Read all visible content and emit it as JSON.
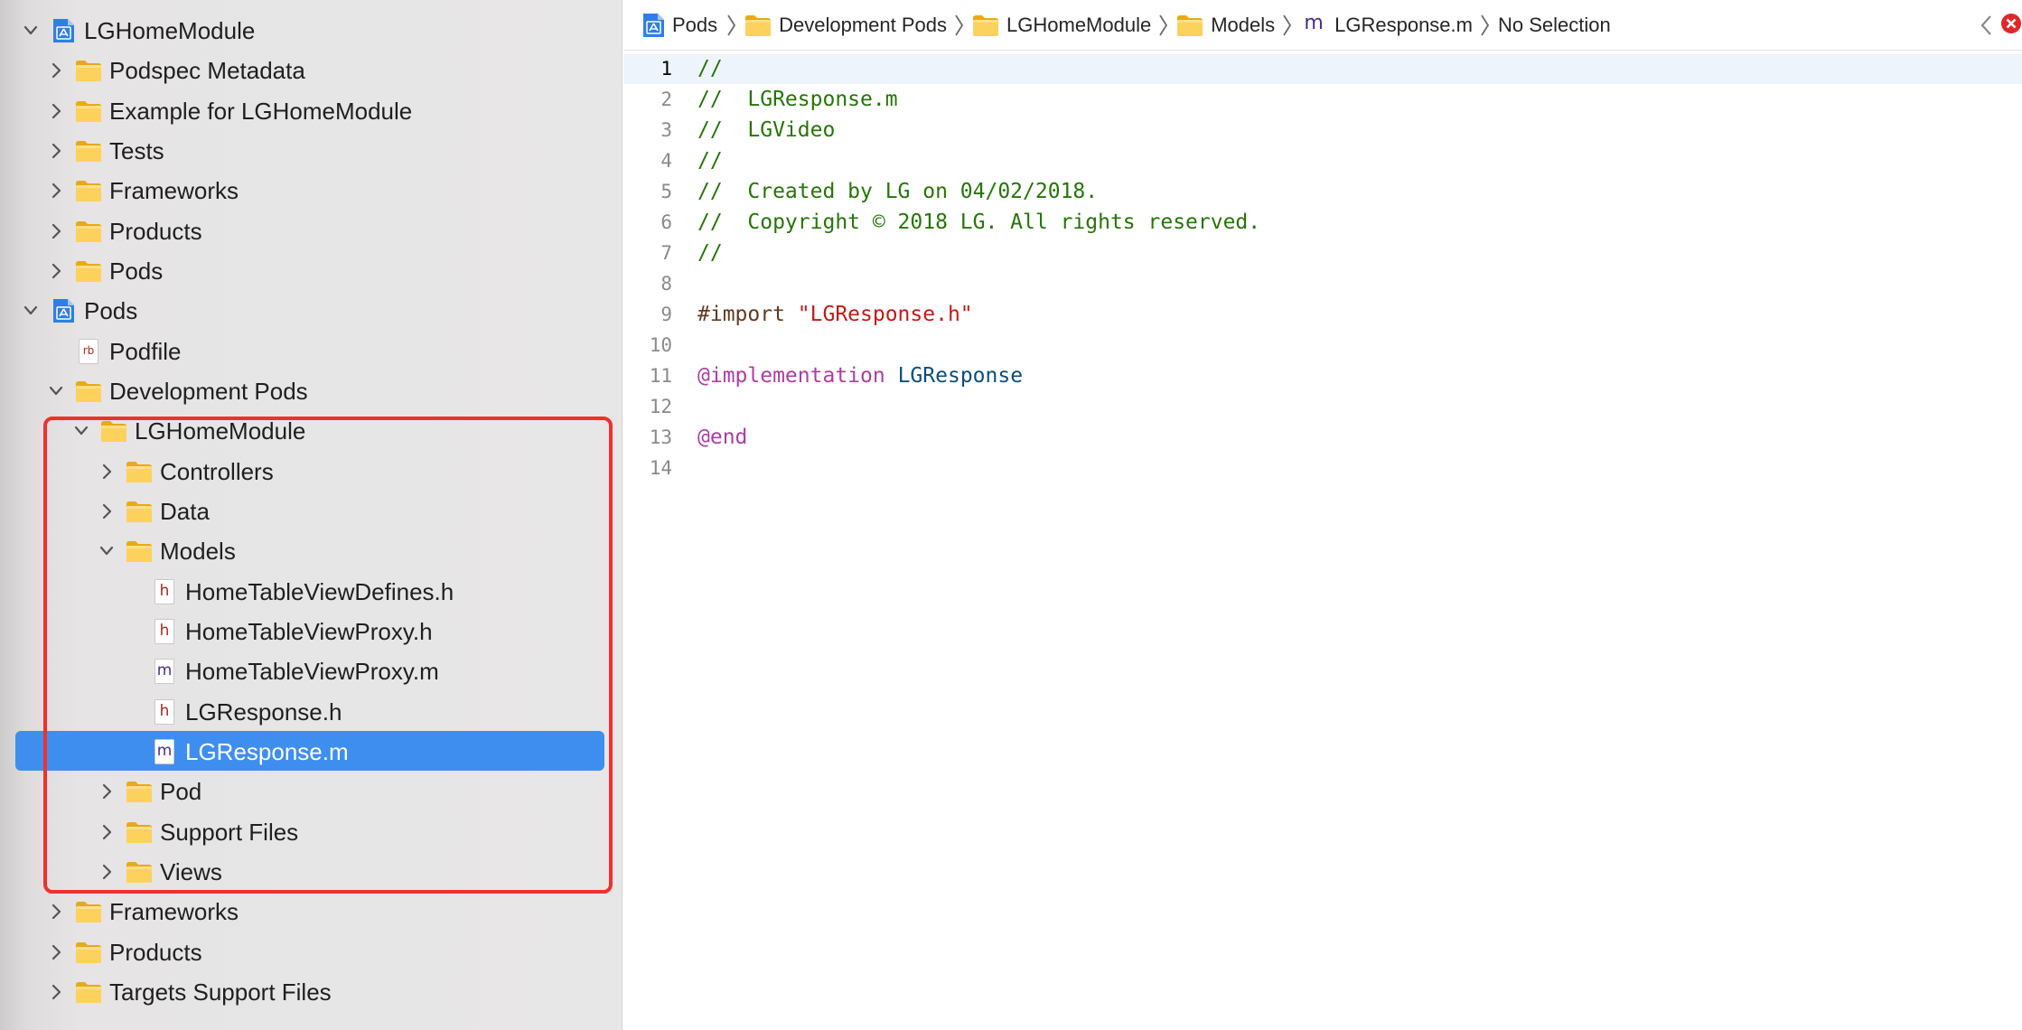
{
  "navigator": {
    "items": [
      {
        "label": "LGHomeModule",
        "level": 0,
        "icon": "project-icon",
        "disclosure": "expanded"
      },
      {
        "label": "Podspec Metadata",
        "level": 1,
        "icon": "folder-icon",
        "disclosure": "collapsed"
      },
      {
        "label": "Example for LGHomeModule",
        "level": 1,
        "icon": "folder-icon",
        "disclosure": "collapsed"
      },
      {
        "label": "Tests",
        "level": 1,
        "icon": "folder-icon",
        "disclosure": "collapsed"
      },
      {
        "label": "Frameworks",
        "level": 1,
        "icon": "folder-icon",
        "disclosure": "collapsed"
      },
      {
        "label": "Products",
        "level": 1,
        "icon": "folder-icon",
        "disclosure": "collapsed"
      },
      {
        "label": "Pods",
        "level": 1,
        "icon": "folder-icon",
        "disclosure": "collapsed"
      },
      {
        "label": "Pods",
        "level": 0,
        "icon": "project-icon",
        "disclosure": "expanded"
      },
      {
        "label": "Podfile",
        "level": 1,
        "icon": "rb-file-icon",
        "disclosure": "none",
        "badge": "rb"
      },
      {
        "label": "Development Pods",
        "level": 1,
        "icon": "folder-icon",
        "disclosure": "expanded"
      },
      {
        "label": "LGHomeModule",
        "level": 2,
        "icon": "folder-icon",
        "disclosure": "expanded"
      },
      {
        "label": "Controllers",
        "level": 3,
        "icon": "folder-icon",
        "disclosure": "collapsed"
      },
      {
        "label": "Data",
        "level": 3,
        "icon": "folder-icon",
        "disclosure": "collapsed"
      },
      {
        "label": "Models",
        "level": 3,
        "icon": "folder-icon",
        "disclosure": "expanded"
      },
      {
        "label": "HomeTableViewDefines.h",
        "level": 4,
        "icon": "h-file-icon",
        "disclosure": "none",
        "badge": "h"
      },
      {
        "label": "HomeTableViewProxy.h",
        "level": 4,
        "icon": "h-file-icon",
        "disclosure": "none",
        "badge": "h"
      },
      {
        "label": "HomeTableViewProxy.m",
        "level": 4,
        "icon": "m-file-icon",
        "disclosure": "none",
        "badge": "m"
      },
      {
        "label": "LGResponse.h",
        "level": 4,
        "icon": "h-file-icon",
        "disclosure": "none",
        "badge": "h"
      },
      {
        "label": "LGResponse.m",
        "level": 4,
        "icon": "m-file-icon",
        "disclosure": "none",
        "badge": "m",
        "selected": true
      },
      {
        "label": "Pod",
        "level": 3,
        "icon": "folder-icon",
        "disclosure": "collapsed"
      },
      {
        "label": "Support Files",
        "level": 3,
        "icon": "folder-icon",
        "disclosure": "collapsed"
      },
      {
        "label": "Views",
        "level": 3,
        "icon": "folder-icon",
        "disclosure": "collapsed"
      },
      {
        "label": "Frameworks",
        "level": 1,
        "icon": "folder-icon",
        "disclosure": "collapsed"
      },
      {
        "label": "Products",
        "level": 1,
        "icon": "folder-icon",
        "disclosure": "collapsed"
      },
      {
        "label": "Targets Support Files",
        "level": 1,
        "icon": "folder-icon",
        "disclosure": "collapsed"
      }
    ],
    "selection_color": "#3e8ef0",
    "highlight_color": "#f0302c"
  },
  "jumpbar": {
    "crumbs": [
      {
        "label": "Pods",
        "icon": "project-icon"
      },
      {
        "label": "Development Pods",
        "icon": "folder-icon"
      },
      {
        "label": "LGHomeModule",
        "icon": "folder-icon"
      },
      {
        "label": "Models",
        "icon": "folder-icon"
      },
      {
        "label": "LGResponse.m",
        "icon": "m-file-icon",
        "badge": "m"
      },
      {
        "label": "No Selection",
        "icon": ""
      }
    ]
  },
  "editor": {
    "current_line": 1,
    "lines": [
      {
        "number": "1",
        "tokens": [
          {
            "t": "//",
            "k": "comment"
          }
        ]
      },
      {
        "number": "2",
        "tokens": [
          {
            "t": "//  LGResponse.m",
            "k": "comment"
          }
        ]
      },
      {
        "number": "3",
        "tokens": [
          {
            "t": "//  LGVideo",
            "k": "comment"
          }
        ]
      },
      {
        "number": "4",
        "tokens": [
          {
            "t": "//",
            "k": "comment"
          }
        ]
      },
      {
        "number": "5",
        "tokens": [
          {
            "t": "//  Created by LG on 04/02/2018.",
            "k": "comment"
          }
        ]
      },
      {
        "number": "6",
        "tokens": [
          {
            "t": "//  Copyright © 2018 LG. All rights reserved.",
            "k": "comment"
          }
        ]
      },
      {
        "number": "7",
        "tokens": [
          {
            "t": "//",
            "k": "comment"
          }
        ]
      },
      {
        "number": "8",
        "tokens": []
      },
      {
        "number": "9",
        "tokens": [
          {
            "t": "#import ",
            "k": "preproc"
          },
          {
            "t": "\"LGResponse.h\"",
            "k": "string"
          }
        ]
      },
      {
        "number": "10",
        "tokens": []
      },
      {
        "number": "11",
        "tokens": [
          {
            "t": "@implementation",
            "k": "keyword"
          },
          {
            "t": " ",
            "k": "plain"
          },
          {
            "t": "LGResponse",
            "k": "type"
          }
        ]
      },
      {
        "number": "12",
        "tokens": []
      },
      {
        "number": "13",
        "tokens": [
          {
            "t": "@end",
            "k": "keyword"
          }
        ]
      },
      {
        "number": "14",
        "tokens": []
      }
    ],
    "colors": {
      "comment": "#267507",
      "preproc": "#643820",
      "string": "#c41a16",
      "keyword": "#ad3da4",
      "type": "#0b4f79"
    }
  }
}
